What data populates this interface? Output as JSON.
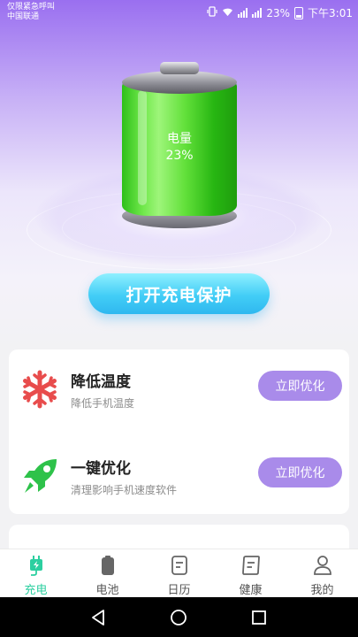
{
  "status_bar": {
    "carrier_line1": "仅限紧急呼叫",
    "carrier_line2": "中国联通",
    "battery_percent": "23%",
    "time": "下午3:01"
  },
  "battery_display": {
    "label": "电量",
    "percent": "23%",
    "level": 0.23
  },
  "protect_button": {
    "label": "打开充电保护"
  },
  "features": [
    {
      "title": "降低温度",
      "subtitle": "降低手机温度",
      "button": "立即优化",
      "icon": "snowflake-icon",
      "icon_color": "#e84c4c"
    },
    {
      "title": "一键优化",
      "subtitle": "清理影响手机速度软件",
      "button": "立即优化",
      "icon": "rocket-icon",
      "icon_color": "#2ec24a"
    }
  ],
  "tabs": [
    {
      "label": "充电",
      "icon": "charge-plug-icon",
      "active": true
    },
    {
      "label": "电池",
      "icon": "battery-icon",
      "active": false
    },
    {
      "label": "日历",
      "icon": "calendar-icon",
      "active": false
    },
    {
      "label": "健康",
      "icon": "health-note-icon",
      "active": false
    },
    {
      "label": "我的",
      "icon": "user-icon",
      "active": false
    }
  ],
  "colors": {
    "accent_purple": "#a98bea",
    "accent_teal": "#2ccfa0",
    "button_cyan": "#42cdf6"
  }
}
